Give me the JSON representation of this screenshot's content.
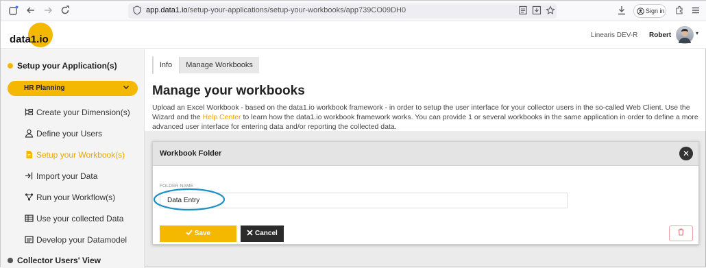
{
  "browser": {
    "url_domain": "app.data1.io",
    "url_path": "/setup-your-applications/setup-your-workbooks/app739CO09DH0",
    "signin_label": "Sign in"
  },
  "header": {
    "logo_text": "data1.io",
    "org_name": "Linearis DEV-R",
    "user_name": "Robert"
  },
  "sidebar": {
    "setup_title": "Setup your Application(s)",
    "app_selector": "HR Planning",
    "items": [
      {
        "label": "Create your Dimension(s)",
        "icon": "hierarchy-icon"
      },
      {
        "label": "Define your Users",
        "icon": "user-icon"
      },
      {
        "label": "Setup your Workbook(s)",
        "icon": "file-icon"
      },
      {
        "label": "Import your Data",
        "icon": "import-icon"
      },
      {
        "label": "Run your Workflow(s)",
        "icon": "workflow-icon"
      },
      {
        "label": "Use your collected Data",
        "icon": "table-icon"
      },
      {
        "label": "Develop your Datamodel",
        "icon": "datamodel-icon"
      }
    ],
    "collector_title": "Collector Users' View",
    "accent_color": "#f5b800"
  },
  "main": {
    "tabs": [
      {
        "label": "Info"
      },
      {
        "label": "Manage Workbooks"
      }
    ],
    "title": "Manage your workbooks",
    "desc_part1": "Upload an Excel Workbook - based on the data1.io workbook framework - in order to setup the user interface for your collector users in the so-called Web Client. Use the Wizard and the ",
    "desc_link": "Help Center",
    "desc_part2": " to learn how the data1.io workbook framework works. You can provide 1 or several workbooks in the same application in order to define a more advanced user interface for entering data and/or reporting the collected data."
  },
  "modal": {
    "title": "Workbook Folder",
    "folder_label": "FOLDER NAME",
    "folder_value": "Data Entry",
    "save_label": "Save",
    "cancel_label": "Cancel"
  }
}
